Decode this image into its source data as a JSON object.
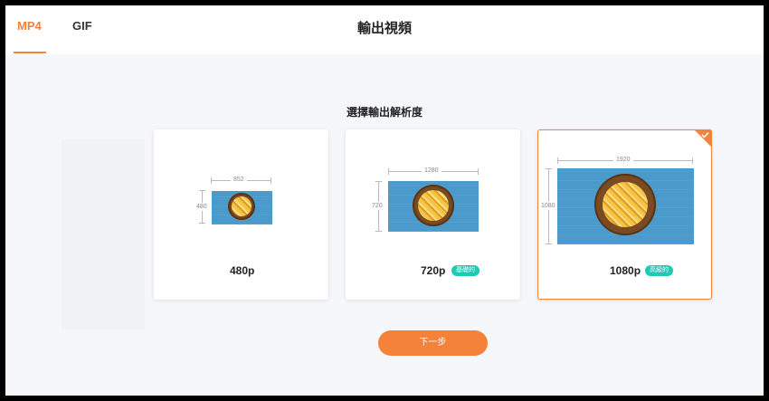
{
  "header": {
    "tabs": [
      {
        "label": "MP4",
        "active": true
      },
      {
        "label": "GIF",
        "active": false
      }
    ],
    "title": "輸出視頻"
  },
  "main": {
    "subtitle": "選擇輸出解析度",
    "options": [
      {
        "resolution": "480p",
        "width_label": "852",
        "height_label": "480",
        "badge": null,
        "selected": false,
        "preview_icon": "food-photo"
      },
      {
        "resolution": "720p",
        "width_label": "1280",
        "height_label": "720",
        "badge": "基礎的",
        "selected": false,
        "preview_icon": "food-photo"
      },
      {
        "resolution": "1080p",
        "width_label": "1920",
        "height_label": "1080",
        "badge": "高級的",
        "selected": true,
        "preview_icon": "food-photo"
      }
    ],
    "next_label": "下一步"
  },
  "colors": {
    "accent": "#f5823a",
    "badge": "#1fc9b3",
    "photo_background": "#4a9acb"
  }
}
